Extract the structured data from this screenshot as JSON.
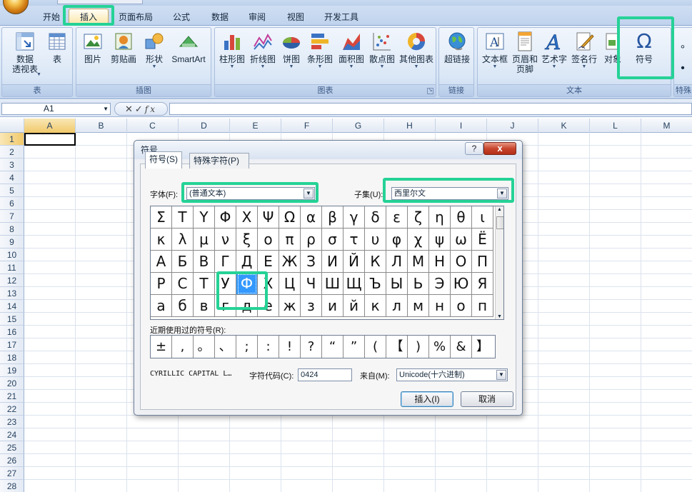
{
  "ribbon": {
    "tabs": [
      "开始",
      "插入",
      "页面布局",
      "公式",
      "数据",
      "审阅",
      "视图",
      "开发工具"
    ],
    "active_tab": "插入",
    "groups": {
      "table": {
        "label": "表",
        "buttons": [
          "数据\n透视表",
          "表"
        ]
      },
      "illustrations": {
        "label": "插图",
        "buttons": [
          "图片",
          "剪贴画",
          "形状",
          "SmartArt"
        ]
      },
      "charts": {
        "label": "图表",
        "buttons": [
          "柱形图",
          "折线图",
          "饼图",
          "条形图",
          "面积图",
          "散点图",
          "其他图表"
        ]
      },
      "links": {
        "label": "链接",
        "buttons": [
          "超链接"
        ]
      },
      "text": {
        "label": "文本",
        "buttons": [
          "文本框",
          "页眉和\n页脚",
          "艺术字",
          "签名行",
          "对象",
          "符号"
        ]
      },
      "special": {
        "label": "特殊"
      }
    }
  },
  "formula_bar": {
    "name_box": "A1",
    "fx": "fx",
    "formula": ""
  },
  "sheet": {
    "columns": [
      "A",
      "B",
      "C",
      "D",
      "E",
      "F",
      "G",
      "H",
      "I",
      "J",
      "K",
      "L",
      "M"
    ],
    "rows": [
      "1",
      "2",
      "3",
      "4",
      "5",
      "6",
      "7",
      "8",
      "9",
      "10",
      "11",
      "12",
      "13",
      "14",
      "15",
      "16",
      "17",
      "18",
      "19",
      "20",
      "21",
      "22",
      "23",
      "24",
      "25",
      "26",
      "27",
      "28"
    ]
  },
  "dialog": {
    "title": "符号",
    "help": "?",
    "close": "x",
    "tabs": [
      "符号(S)",
      "特殊字符(P)"
    ],
    "font_label": "字体(F):",
    "font_value": "(普通文本)",
    "subset_label": "子集(U):",
    "subset_value": "西里尔文",
    "symbols": [
      [
        "Σ",
        "Τ",
        "Υ",
        "Φ",
        "Χ",
        "Ψ",
        "Ω",
        "α",
        "β",
        "γ",
        "δ",
        "ε",
        "ζ",
        "η",
        "θ",
        "ι"
      ],
      [
        "κ",
        "λ",
        "μ",
        "ν",
        "ξ",
        "ο",
        "π",
        "ρ",
        "σ",
        "τ",
        "υ",
        "φ",
        "χ",
        "ψ",
        "ω",
        "Ё"
      ],
      [
        "А",
        "Б",
        "В",
        "Г",
        "Д",
        "Е",
        "Ж",
        "З",
        "И",
        "Й",
        "К",
        "Л",
        "М",
        "Н",
        "О",
        "П"
      ],
      [
        "Р",
        "С",
        "Т",
        "У",
        "Ф",
        "Х",
        "Ц",
        "Ч",
        "Ш",
        "Щ",
        "Ъ",
        "Ы",
        "Ь",
        "Э",
        "Ю",
        "Я"
      ],
      [
        "а",
        "б",
        "в",
        "г",
        "д",
        "е",
        "ж",
        "з",
        "и",
        "й",
        "к",
        "л",
        "м",
        "н",
        "о",
        "п"
      ]
    ],
    "selected": {
      "row": 3,
      "col": 4
    },
    "recent_label": "近期使用过的符号(R):",
    "recent": [
      "±",
      ",",
      "。",
      "、",
      ";",
      ":",
      "!",
      "?",
      "“",
      "”",
      "(",
      "【",
      ")",
      "%",
      "&",
      "】"
    ],
    "char_name": "CYRILLIC CAPITAL L…",
    "char_code_label": "字符代码(C):",
    "char_code_value": "0424",
    "from_label": "来自(M):",
    "from_value": "Unicode(十六进制)",
    "insert_label": "插入(I)",
    "cancel_label": "取消"
  }
}
